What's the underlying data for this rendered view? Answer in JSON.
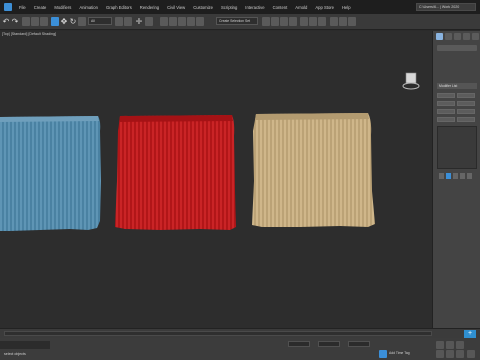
{
  "menubar": {
    "items": [
      "File",
      "Create",
      "Modifiers",
      "Animation",
      "Graph Editors",
      "Rendering",
      "Civil View",
      "Customize",
      "Scripting",
      "Interactive",
      "Content",
      "Arnold",
      "App Store",
      "Help"
    ],
    "workspace": "C:\\Users\\6... | Work 2020"
  },
  "toolbar": {
    "selection_filter": "All",
    "named_selection": "Create Selection Set"
  },
  "viewport": {
    "label": "[Top] [Standard] [Default Shading]"
  },
  "command_panel": {
    "modifier_list": "Modifier List"
  },
  "statusbar": {
    "status_text": "select objects",
    "add_time_tag": "Add Time Tag"
  },
  "colors": {
    "accent": "#3b8fd8",
    "tassel_blue": "#4f88a9",
    "tassel_red": "#c0181b",
    "tassel_tan": "#c9b083",
    "viewport_bg": "#2d2d2d"
  }
}
